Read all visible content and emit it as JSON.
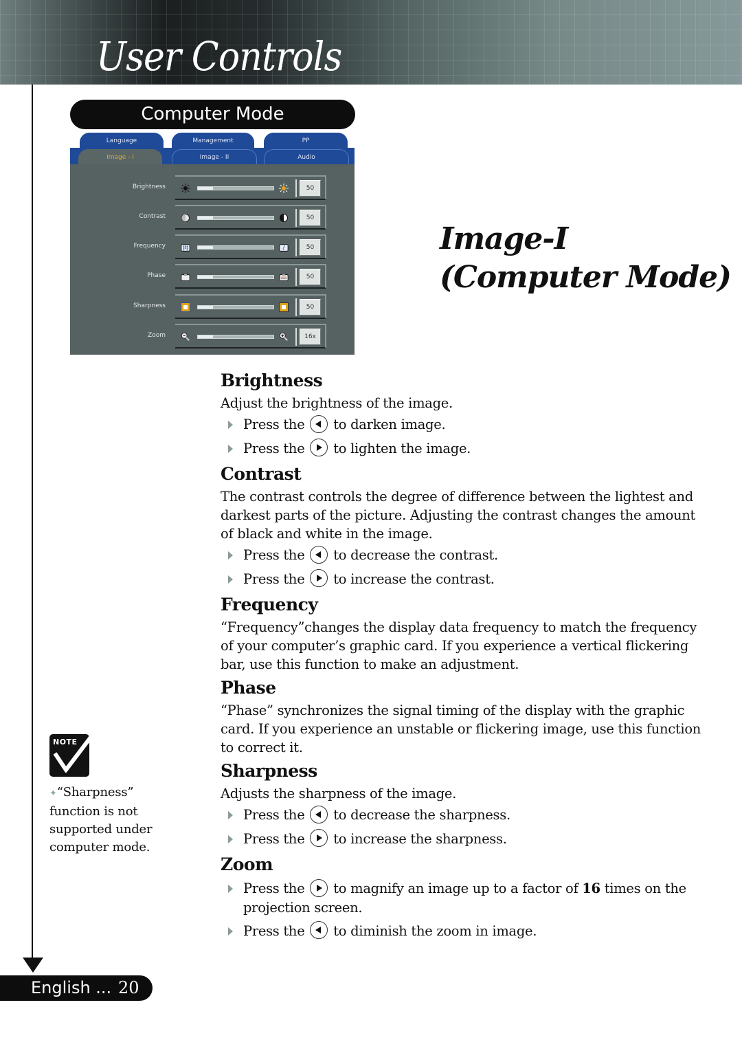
{
  "header": {
    "title": "User Controls"
  },
  "mode_pill": {
    "label": "Computer Mode"
  },
  "osd": {
    "tabs_top": [
      {
        "label": "Language"
      },
      {
        "label": "Management"
      },
      {
        "label": "PP"
      }
    ],
    "tabs_bottom": [
      {
        "label": "Image - I",
        "active": true
      },
      {
        "label": "Image - II",
        "active": false
      },
      {
        "label": "Audio",
        "active": false
      }
    ],
    "rows": [
      {
        "label": "Brightness",
        "value": "50",
        "fill_fraction": 0.2,
        "icon_left": "sun-dark-icon",
        "icon_right": "sun-bright-icon"
      },
      {
        "label": "Contrast",
        "value": "50",
        "fill_fraction": 0.2,
        "icon_left": "contrast-low-icon",
        "icon_right": "contrast-high-icon"
      },
      {
        "label": "Frequency",
        "value": "50",
        "fill_fraction": 0.2,
        "icon_left": "frequency-low-icon",
        "icon_right": "frequency-high-icon"
      },
      {
        "label": "Phase",
        "value": "50",
        "fill_fraction": 0.2,
        "icon_left": "phase-low-icon",
        "icon_right": "phase-high-icon"
      },
      {
        "label": "Sharpness",
        "value": "50",
        "fill_fraction": 0.2,
        "icon_left": "sharpness-low-icon",
        "icon_right": "sharpness-high-icon"
      },
      {
        "label": "Zoom",
        "value": "16x",
        "fill_fraction": 0.2,
        "icon_left": "zoom-out-icon",
        "icon_right": "zoom-in-icon"
      }
    ],
    "colors": {
      "tab_blue": "#1e4a98",
      "panel_gray": "#566261",
      "active_tab_text": "#d9a93c"
    }
  },
  "page_title": {
    "line1": "Image-I",
    "line2": "(Computer Mode)"
  },
  "sections": {
    "brightness": {
      "heading": "Brightness",
      "description": "Adjust the brightness of the image.",
      "bullets": [
        {
          "prefix": "Press the",
          "button": "left",
          "suffix": "to darken image."
        },
        {
          "prefix": "Press the",
          "button": "right",
          "suffix": "to lighten the image."
        }
      ]
    },
    "contrast": {
      "heading": "Contrast",
      "description": "The contrast controls the degree of difference between the lightest and darkest parts of the picture. Adjusting the contrast changes the amount of black and white in the image.",
      "bullets": [
        {
          "prefix": "Press the",
          "button": "left",
          "suffix": "to decrease the contrast."
        },
        {
          "prefix": "Press the",
          "button": "right",
          "suffix": "to increase the contrast."
        }
      ]
    },
    "frequency": {
      "heading": "Frequency",
      "description": "“Frequency”changes the display data frequency to match the frequency of your computer’s graphic card. If you experience a vertical flickering bar, use this function to make an adjustment."
    },
    "phase": {
      "heading": "Phase",
      "description": "“Phase” synchronizes the signal timing of the display with the graphic card. If you experience an unstable or flickering image, use this function to correct it."
    },
    "sharpness": {
      "heading": "Sharpness",
      "description": "Adjusts the sharpness of the image.",
      "bullets": [
        {
          "prefix": "Press the",
          "button": "left",
          "suffix": "to decrease the sharpness."
        },
        {
          "prefix": "Press the",
          "button": "right",
          "suffix": "to increase the sharpness."
        }
      ]
    },
    "zoom": {
      "heading": "Zoom",
      "bullets": [
        {
          "prefix": "Press the",
          "button": "right",
          "suffix_before_bold": "to magnify an image up to a factor of",
          "bold": "16",
          "suffix_after_bold": "times on the projection screen."
        },
        {
          "prefix": "Press the",
          "button": "left",
          "suffix": "to diminish the zoom in image."
        }
      ]
    }
  },
  "note": {
    "badge": "NOTE",
    "text": "“Sharpness” function is not supported under computer mode."
  },
  "footer": {
    "language": "English ...",
    "page_number": "20"
  }
}
